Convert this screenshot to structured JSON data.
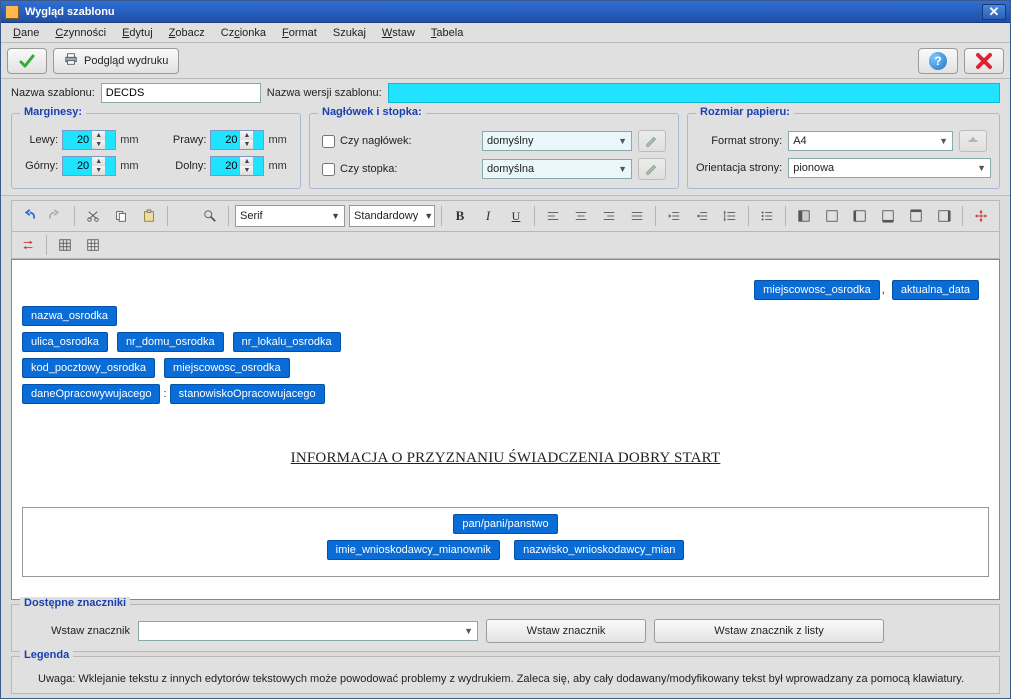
{
  "window": {
    "title": "Wygląd szablonu"
  },
  "menu": {
    "dane": "Dane",
    "czynnosci": "Czynności",
    "edytuj": "Edytuj",
    "zobacz": "Zobacz",
    "czcionka": "Czcionka",
    "format": "Format",
    "szukaj": "Szukaj",
    "wstaw": "Wstaw",
    "tabela": "Tabela"
  },
  "toolbar1": {
    "print_preview": "Podgląd wydruku"
  },
  "namerow": {
    "template_label": "Nazwa szablonu:",
    "template_value": "DECDS",
    "version_label": "Nazwa wersji szablonu:",
    "version_value": ""
  },
  "margins": {
    "legend": "Marginesy:",
    "left_label": "Lewy:",
    "left_value": "20",
    "right_label": "Prawy:",
    "right_value": "20",
    "top_label": "Górny:",
    "top_value": "20",
    "bottom_label": "Dolny:",
    "bottom_value": "20",
    "unit": "mm"
  },
  "headerfooter": {
    "legend": "Nagłówek i stopka:",
    "header_label": "Czy nagłówek:",
    "header_value": "domyślny",
    "footer_label": "Czy stopka:",
    "footer_value": "domyślna"
  },
  "paper": {
    "legend": "Rozmiar papieru:",
    "format_label": "Format strony:",
    "format_value": "A4",
    "orient_label": "Orientacja strony:",
    "orient_value": "pionowa"
  },
  "editor_toolbar": {
    "font": "Serif",
    "style": "Standardowy",
    "bold": "B",
    "italic": "I",
    "underline": "U"
  },
  "document": {
    "top_right": {
      "place": "miejscowosc_osrodka",
      "date": "aktualna_data"
    },
    "org": {
      "name": "nazwa_osrodka",
      "street": "ulica_osrodka",
      "house": "nr_domu_osrodka",
      "flat": "nr_lokalu_osrodka",
      "zip": "kod_pocztowy_osrodka",
      "city": "miejscowosc_osrodka",
      "person": "daneOpracowywujacego",
      "position": "stanowiskoOpracowujacego"
    },
    "title": "INFORMACJA O PRZYZNANIU ŚWIADCZENIA DOBRY START ",
    "addressee": {
      "salutation": "pan/pani/panstwo",
      "first": "imie_wnioskodawcy_mianownik",
      "last": "nazwisko_wnioskodawcy_mian"
    }
  },
  "tags_panel": {
    "legend": "Dostępne znaczniki",
    "insert_label": "Wstaw znacznik",
    "insert_btn": "Wstaw znacznik",
    "insert_list_btn": "Wstaw znacznik z listy"
  },
  "legend_panel": {
    "legend": "Legenda",
    "note": "Uwaga: Wklejanie tekstu z innych edytorów tekstowych może powodować problemy z wydrukiem. Zaleca się, aby cały dodawany/modyfikowany tekst był wprowadzany za pomocą klawiatury."
  }
}
